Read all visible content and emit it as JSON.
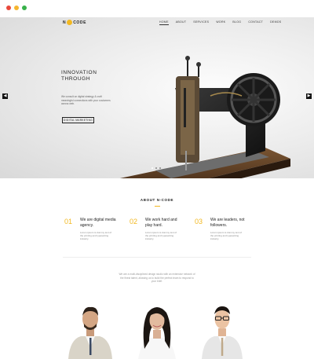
{
  "nav": {
    "logo_left": "N",
    "logo_right": "CODE",
    "items": [
      "HOME",
      "ABOUT",
      "SERVICES",
      "WORK",
      "BLOG",
      "CONTACT",
      "DEMOS"
    ]
  },
  "hero": {
    "title_line1": "INNOVATION",
    "title_line2": "THROUGH",
    "text": "We consult on digital strategy & craft meaningful connections with your customers across web.",
    "button": "DIGITAL MARKETING",
    "prev": "◀",
    "next": "▶"
  },
  "about": {
    "title": "ABOUT N-CODE",
    "features": [
      {
        "num": "01",
        "title": "We are digital media agency.",
        "desc": "Lorem ipsum is dummy text of the printing and typesetting industry."
      },
      {
        "num": "02",
        "title": "We work hard and play hard.",
        "desc": "Lorem ipsum is dummy text of the printing and typesetting industry."
      },
      {
        "num": "03",
        "title": "We are leaders, not followers.",
        "desc": "Lorem ipsum is dummy text of the printing and typesetting industry."
      }
    ],
    "mission": "We are a multi-disciplined design studio with an extensive network of the finest talent, allowing us to build the perfect team to respond to your brief."
  },
  "colors": {
    "accent": "#f2b821",
    "dark": "#222222"
  }
}
